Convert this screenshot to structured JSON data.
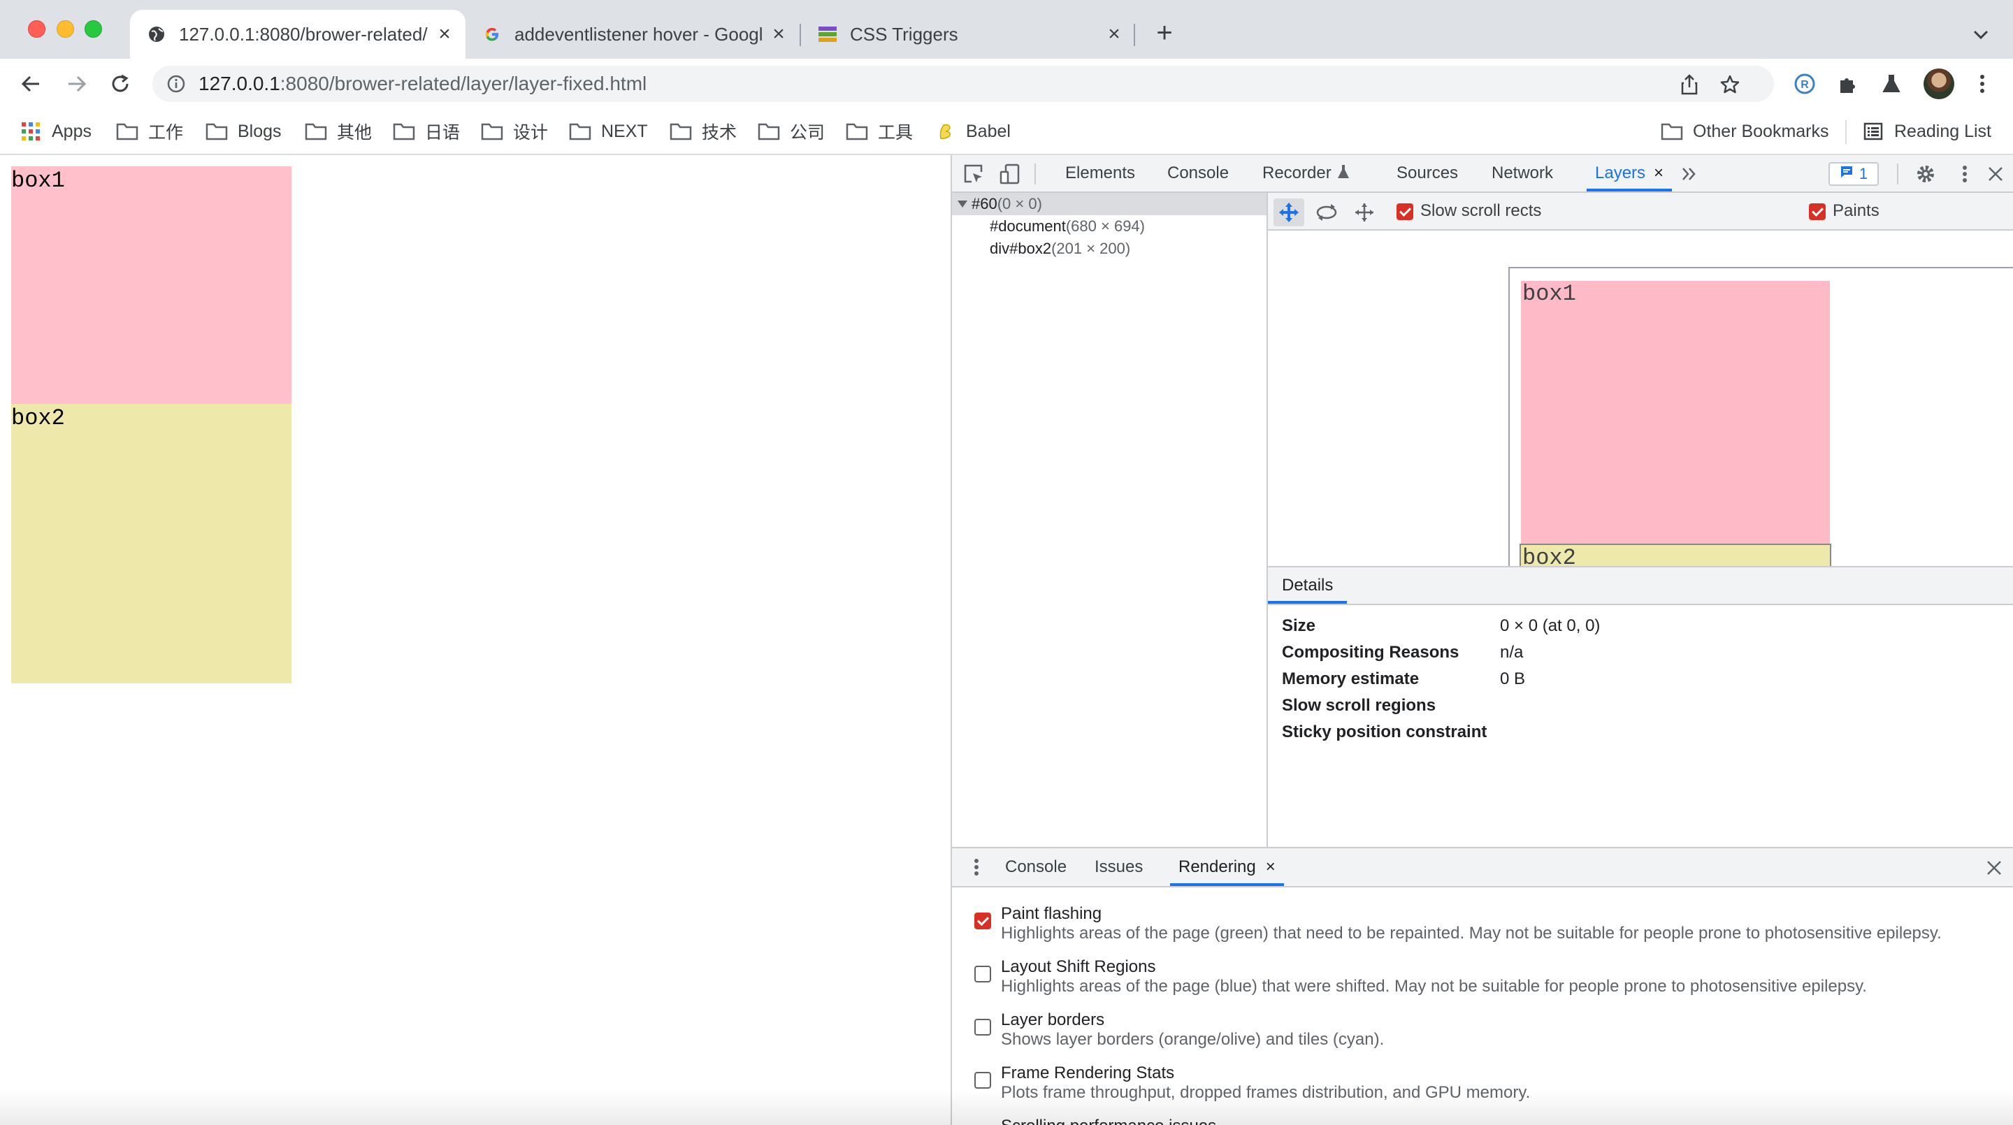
{
  "tabs": [
    {
      "title": "127.0.0.1:8080/brower-related/",
      "favicon": "globe-icon",
      "active": true
    },
    {
      "title": "addeventlistener hover - Googl",
      "favicon": "google-g-icon",
      "active": false
    },
    {
      "title": "CSS Triggers",
      "favicon": "css-triggers-icon",
      "active": false
    }
  ],
  "new_tab_label": "+",
  "address": {
    "host": "127.0.0.1",
    "rest": ":8080/brower-related/layer/layer-fixed.html"
  },
  "bookmarks": [
    {
      "label": "Apps",
      "icon": "apps-grid-icon"
    },
    {
      "label": "工作",
      "icon": "folder-icon"
    },
    {
      "label": "Blogs",
      "icon": "folder-icon"
    },
    {
      "label": "其他",
      "icon": "folder-icon"
    },
    {
      "label": "日语",
      "icon": "folder-icon"
    },
    {
      "label": "设计",
      "icon": "folder-icon"
    },
    {
      "label": "NEXT",
      "icon": "folder-icon"
    },
    {
      "label": "技术",
      "icon": "folder-icon"
    },
    {
      "label": "公司",
      "icon": "folder-icon"
    },
    {
      "label": "工具",
      "icon": "folder-icon"
    },
    {
      "label": "Babel",
      "icon": "babel-icon"
    }
  ],
  "other_bookmarks": "Other Bookmarks",
  "reading_list": "Reading List",
  "page": {
    "box1": "box1",
    "box2": "box2"
  },
  "colors": {
    "box1": "#ffc0cb",
    "box2": "#eee8aa",
    "accent": "#1a73e8",
    "checkbox": "#d93025"
  },
  "devtools": {
    "tabs": [
      "Elements",
      "Console",
      "Recorder",
      "Sources",
      "Network",
      "Layers"
    ],
    "issues_count": "1",
    "tree": [
      {
        "name": "#60",
        "dims": "(0 × 0)"
      },
      {
        "name": "#document",
        "dims": "(680 × 694)"
      },
      {
        "name": "div#box2",
        "dims": "(201 × 200)"
      }
    ],
    "layers_toolbar": {
      "slow_scroll_rects": "Slow scroll rects",
      "paints": "Paints"
    },
    "layer_view": {
      "box1": "box1",
      "box2": "box2"
    },
    "details_tab": "Details",
    "details": [
      {
        "key": "Size",
        "value": "0 × 0 (at 0, 0)"
      },
      {
        "key": "Compositing Reasons",
        "value": "n/a"
      },
      {
        "key": "Memory estimate",
        "value": "0 B"
      },
      {
        "key": "Slow scroll regions",
        "value": ""
      },
      {
        "key": "Sticky position constraint",
        "value": ""
      }
    ],
    "drawer_tabs": [
      "Console",
      "Issues",
      "Rendering"
    ],
    "rendering_options": [
      {
        "title": "Paint flashing",
        "desc": "Highlights areas of the page (green) that need to be repainted. May not be suitable for people prone to photosensitive epilepsy.",
        "checked": true
      },
      {
        "title": "Layout Shift Regions",
        "desc": "Highlights areas of the page (blue) that were shifted. May not be suitable for people prone to photosensitive epilepsy.",
        "checked": false
      },
      {
        "title": "Layer borders",
        "desc": "Shows layer borders (orange/olive) and tiles (cyan).",
        "checked": false
      },
      {
        "title": "Frame Rendering Stats",
        "desc": "Plots frame throughput, dropped frames distribution, and GPU memory.",
        "checked": false
      },
      {
        "title": "Scrolling performance issues",
        "desc": "",
        "checked": false
      }
    ]
  }
}
